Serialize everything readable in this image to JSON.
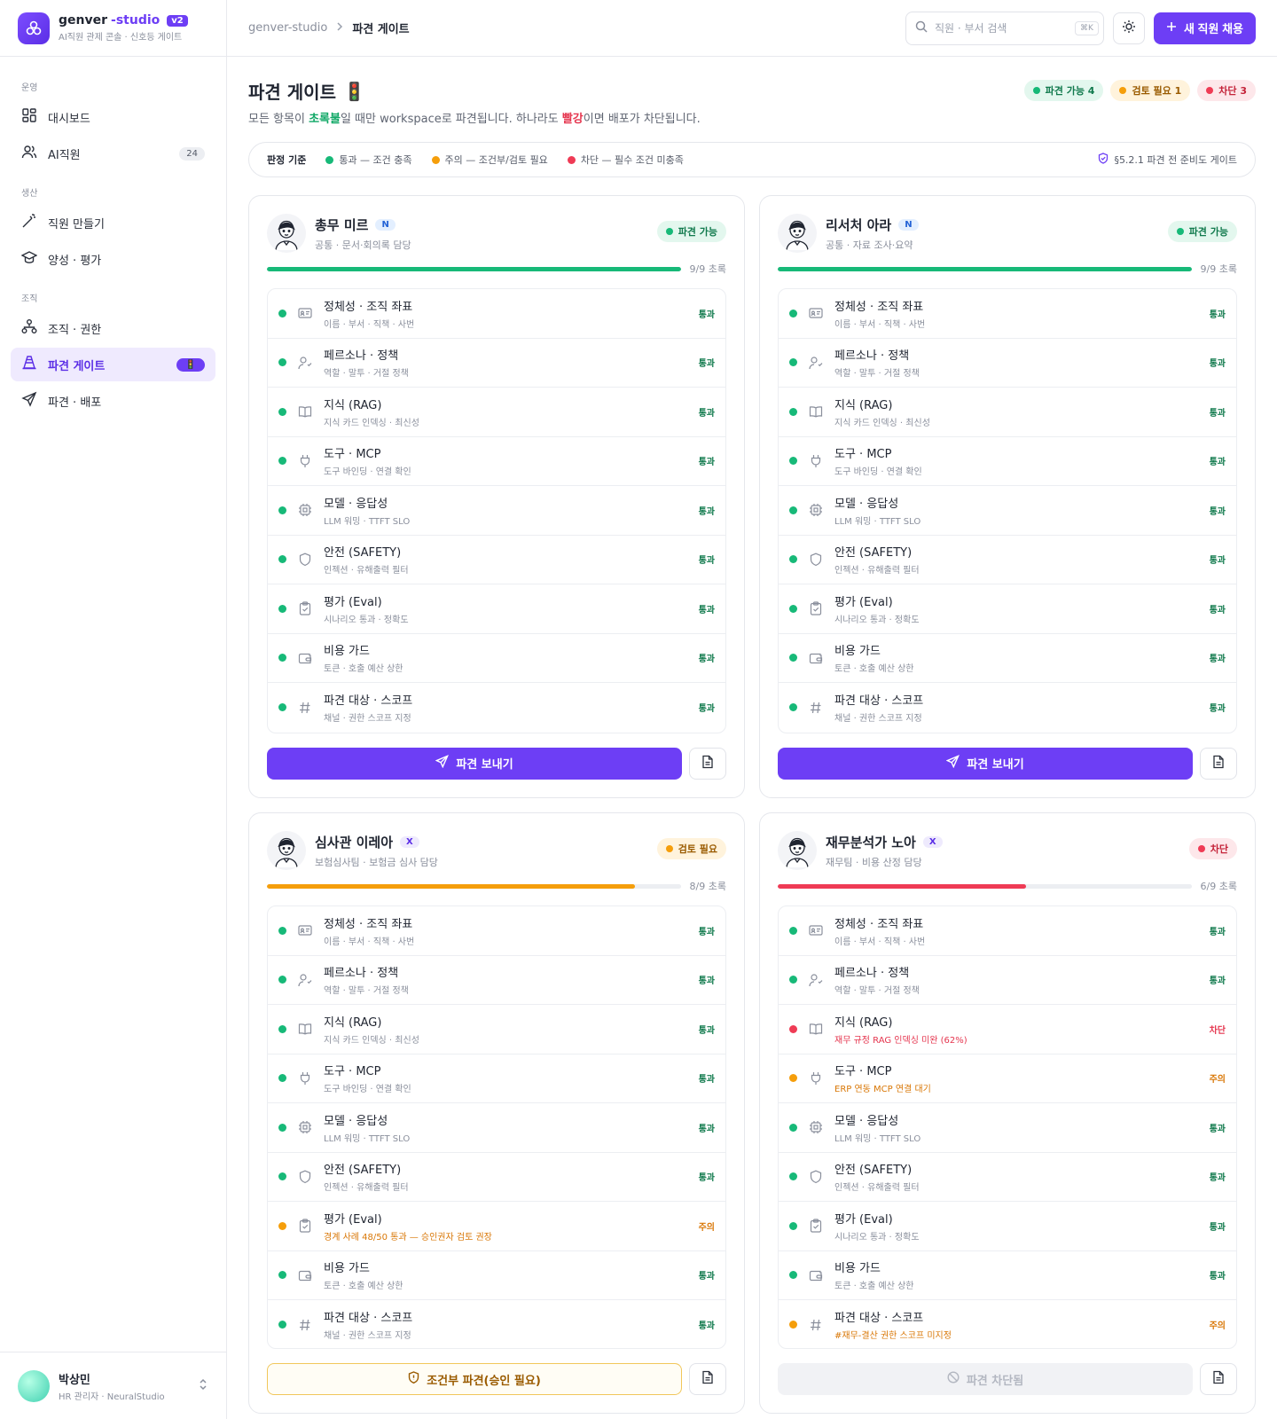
{
  "brand": {
    "name": "genver",
    "accent": "-studio",
    "version": "v2",
    "subtitle": "AI직원 관제 콘솔 · 신호등 게이트"
  },
  "sidebar": {
    "sections": [
      {
        "label": "운영",
        "items": [
          {
            "label": "대시보드",
            "icon": "dashboard-icon"
          },
          {
            "label": "AI직원",
            "icon": "users-icon",
            "badge": "24"
          }
        ]
      },
      {
        "label": "생산",
        "items": [
          {
            "label": "직원 만들기",
            "icon": "wand-icon"
          },
          {
            "label": "양성 · 평가",
            "icon": "graduation-icon"
          }
        ]
      },
      {
        "label": "조직",
        "items": [
          {
            "label": "조직 · 권한",
            "icon": "org-icon"
          },
          {
            "label": "파견 게이트",
            "icon": "cone-icon",
            "badge": "🚦",
            "active": true
          },
          {
            "label": "파견 · 배포",
            "icon": "send-icon"
          }
        ]
      }
    ]
  },
  "user": {
    "name": "박상민",
    "role": "HR 관리자 · NeuralStudio"
  },
  "topbar": {
    "breadcrumb": [
      "genver-studio",
      "파견 게이트"
    ],
    "search_placeholder": "직원 · 부서 검색",
    "search_kbd": "⌘K",
    "new_button": "새 직원 채용"
  },
  "page": {
    "title": "파견 게이트",
    "title_emoji": "🚦",
    "desc_1": "모든 항목이 ",
    "desc_green": "초록불",
    "desc_2": "일 때만 workspace로 파견됩니다. 하나라도 ",
    "desc_red": "빨강",
    "desc_3": "이면 배포가 차단됩니다.",
    "pills": {
      "green": "파견 가능 4",
      "amber": "검토 필요 1",
      "red": "차단 3"
    }
  },
  "legend": {
    "title": "판정 기준",
    "pass": "통과 — 조건 충족",
    "warn": "주의 — 조건부/검토 필요",
    "block": "차단 — 필수 조건 미충족",
    "ref": "§5.2.1 파견 전 준비도 게이트"
  },
  "colors": {
    "green": "#17b978",
    "amber": "#f59e0b",
    "red": "#ef3b55",
    "brand": "#6d3ef5"
  },
  "cards": [
    {
      "name": "총무 미르",
      "tag": "N",
      "tag_type": "n",
      "sub": "공통 · 문서·회의록 담당",
      "status": "파견 가능",
      "status_type": "green",
      "progress": 1.0,
      "progress_label": "9/9 초록",
      "checks": [
        {
          "name": "정체성 · 조직 좌표",
          "sub": "이름 · 부서 · 직책 · 사번",
          "result": "통과",
          "level": "green",
          "icon": "id-card-icon"
        },
        {
          "name": "페르소나 · 정책",
          "sub": "역할 · 말투 · 거절 정책",
          "result": "통과",
          "level": "green",
          "icon": "persona-icon"
        },
        {
          "name": "지식 (RAG)",
          "sub": "지식 카드 인덱싱 · 최신성",
          "result": "통과",
          "level": "green",
          "icon": "book-icon"
        },
        {
          "name": "도구 · MCP",
          "sub": "도구 바인딩 · 연결 확인",
          "result": "통과",
          "level": "green",
          "icon": "plug-icon"
        },
        {
          "name": "모델 · 응답성",
          "sub": "LLM 워밍 · TTFT SLO",
          "result": "통과",
          "level": "green",
          "icon": "chip-icon"
        },
        {
          "name": "안전 (SAFETY)",
          "sub": "인젝션 · 유해출력 필터",
          "result": "통과",
          "level": "green",
          "icon": "shield-icon"
        },
        {
          "name": "평가 (Eval)",
          "sub": "시나리오 통과 · 정확도",
          "result": "통과",
          "level": "green",
          "icon": "clipboard-icon"
        },
        {
          "name": "비용 가드",
          "sub": "토큰 · 호출 예산 상한",
          "result": "통과",
          "level": "green",
          "icon": "wallet-icon"
        },
        {
          "name": "파견 대상 · 스코프",
          "sub": "채널 · 권한 스코프 지정",
          "result": "통과",
          "level": "green",
          "icon": "hash-icon"
        }
      ],
      "action": "파견 보내기",
      "action_type": "primary"
    },
    {
      "name": "리서처 아라",
      "tag": "N",
      "tag_type": "n",
      "sub": "공통 · 자료 조사·요약",
      "status": "파견 가능",
      "status_type": "green",
      "progress": 1.0,
      "progress_label": "9/9 초록",
      "checks": [
        {
          "name": "정체성 · 조직 좌표",
          "sub": "이름 · 부서 · 직책 · 사번",
          "result": "통과",
          "level": "green",
          "icon": "id-card-icon"
        },
        {
          "name": "페르소나 · 정책",
          "sub": "역할 · 말투 · 거절 정책",
          "result": "통과",
          "level": "green",
          "icon": "persona-icon"
        },
        {
          "name": "지식 (RAG)",
          "sub": "지식 카드 인덱싱 · 최신성",
          "result": "통과",
          "level": "green",
          "icon": "book-icon"
        },
        {
          "name": "도구 · MCP",
          "sub": "도구 바인딩 · 연결 확인",
          "result": "통과",
          "level": "green",
          "icon": "plug-icon"
        },
        {
          "name": "모델 · 응답성",
          "sub": "LLM 워밍 · TTFT SLO",
          "result": "통과",
          "level": "green",
          "icon": "chip-icon"
        },
        {
          "name": "안전 (SAFETY)",
          "sub": "인젝션 · 유해출력 필터",
          "result": "통과",
          "level": "green",
          "icon": "shield-icon"
        },
        {
          "name": "평가 (Eval)",
          "sub": "시나리오 통과 · 정확도",
          "result": "통과",
          "level": "green",
          "icon": "clipboard-icon"
        },
        {
          "name": "비용 가드",
          "sub": "토큰 · 호출 예산 상한",
          "result": "통과",
          "level": "green",
          "icon": "wallet-icon"
        },
        {
          "name": "파견 대상 · 스코프",
          "sub": "채널 · 권한 스코프 지정",
          "result": "통과",
          "level": "green",
          "icon": "hash-icon"
        }
      ],
      "action": "파견 보내기",
      "action_type": "primary"
    },
    {
      "name": "심사관 이레아",
      "tag": "X",
      "tag_type": "x",
      "sub": "보험심사팀 · 보험금 심사 담당",
      "status": "검토 필요",
      "status_type": "amber",
      "progress": 0.889,
      "progress_label": "8/9 초록",
      "checks": [
        {
          "name": "정체성 · 조직 좌표",
          "sub": "이름 · 부서 · 직책 · 사번",
          "result": "통과",
          "level": "green",
          "icon": "id-card-icon"
        },
        {
          "name": "페르소나 · 정책",
          "sub": "역할 · 말투 · 거절 정책",
          "result": "통과",
          "level": "green",
          "icon": "persona-icon"
        },
        {
          "name": "지식 (RAG)",
          "sub": "지식 카드 인덱싱 · 최신성",
          "result": "통과",
          "level": "green",
          "icon": "book-icon"
        },
        {
          "name": "도구 · MCP",
          "sub": "도구 바인딩 · 연결 확인",
          "result": "통과",
          "level": "green",
          "icon": "plug-icon"
        },
        {
          "name": "모델 · 응답성",
          "sub": "LLM 워밍 · TTFT SLO",
          "result": "통과",
          "level": "green",
          "icon": "chip-icon"
        },
        {
          "name": "안전 (SAFETY)",
          "sub": "인젝션 · 유해출력 필터",
          "result": "통과",
          "level": "green",
          "icon": "shield-icon"
        },
        {
          "name": "평가 (Eval)",
          "sub": "경계 사례 48/50 통과 — 승인권자 검토 권장",
          "result": "주의",
          "level": "amber",
          "icon": "clipboard-icon"
        },
        {
          "name": "비용 가드",
          "sub": "토큰 · 호출 예산 상한",
          "result": "통과",
          "level": "green",
          "icon": "wallet-icon"
        },
        {
          "name": "파견 대상 · 스코프",
          "sub": "채널 · 권한 스코프 지정",
          "result": "통과",
          "level": "green",
          "icon": "hash-icon"
        }
      ],
      "action": "조건부 파견(승인 필요)",
      "action_type": "warn"
    },
    {
      "name": "재무분석가 노아",
      "tag": "X",
      "tag_type": "x",
      "sub": "재무팀 · 비용 산정 담당",
      "status": "차단",
      "status_type": "red",
      "progress": 0.6,
      "progress_label": "6/9 초록",
      "checks": [
        {
          "name": "정체성 · 조직 좌표",
          "sub": "이름 · 부서 · 직책 · 사번",
          "result": "통과",
          "level": "green",
          "icon": "id-card-icon"
        },
        {
          "name": "페르소나 · 정책",
          "sub": "역할 · 말투 · 거절 정책",
          "result": "통과",
          "level": "green",
          "icon": "persona-icon"
        },
        {
          "name": "지식 (RAG)",
          "sub": "재무 규정 RAG 인덱싱 미완 (62%)",
          "result": "차단",
          "level": "red",
          "icon": "book-icon"
        },
        {
          "name": "도구 · MCP",
          "sub": "ERP 연동 MCP 연결 대기",
          "result": "주의",
          "level": "amber",
          "icon": "plug-icon"
        },
        {
          "name": "모델 · 응답성",
          "sub": "LLM 워밍 · TTFT SLO",
          "result": "통과",
          "level": "green",
          "icon": "chip-icon"
        },
        {
          "name": "안전 (SAFETY)",
          "sub": "인젝션 · 유해출력 필터",
          "result": "통과",
          "level": "green",
          "icon": "shield-icon"
        },
        {
          "name": "평가 (Eval)",
          "sub": "시나리오 통과 · 정확도",
          "result": "통과",
          "level": "green",
          "icon": "clipboard-icon"
        },
        {
          "name": "비용 가드",
          "sub": "토큰 · 호출 예산 상한",
          "result": "통과",
          "level": "green",
          "icon": "wallet-icon"
        },
        {
          "name": "파견 대상 · 스코프",
          "sub": "#재무-결산 권한 스코프 미지정",
          "result": "주의",
          "level": "amber",
          "icon": "hash-icon"
        }
      ],
      "action": "파견 차단됨",
      "action_type": "disabled"
    }
  ]
}
